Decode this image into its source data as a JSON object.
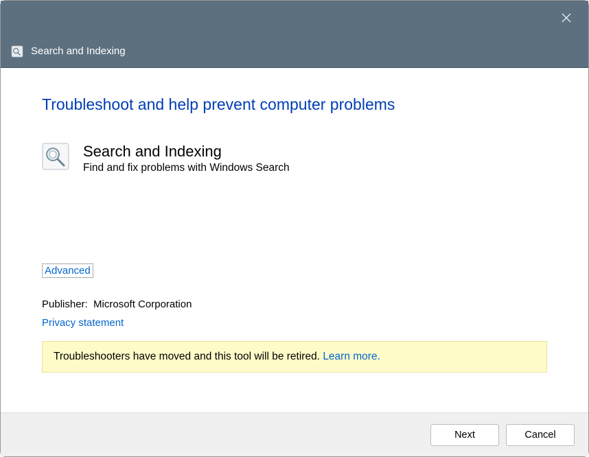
{
  "titlebar": {
    "close_aria": "Close"
  },
  "header": {
    "title": "Search and Indexing"
  },
  "content": {
    "heading": "Troubleshoot and help prevent computer problems",
    "troubleshooter": {
      "title": "Search and Indexing",
      "description": "Find and fix problems with Windows Search"
    },
    "advanced_label": "Advanced",
    "publisher_label": "Publisher:",
    "publisher_value": "Microsoft Corporation",
    "privacy_label": "Privacy statement",
    "notice_text": "Troubleshooters have moved and this tool will be retired. ",
    "notice_link": "Learn more."
  },
  "footer": {
    "next_label": "Next",
    "cancel_label": "Cancel"
  }
}
